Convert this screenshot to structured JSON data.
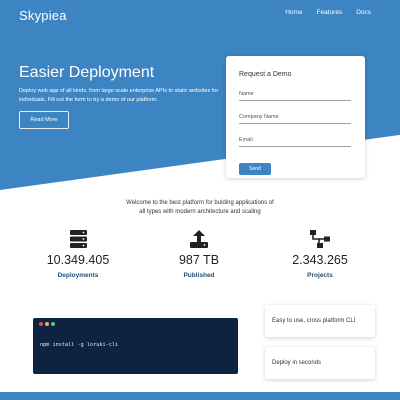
{
  "brand": "Skypiea",
  "nav": {
    "items": [
      "Home",
      "Features",
      "Docs"
    ]
  },
  "hero": {
    "title": "Easier Deployment",
    "text": "Deploy web app of all kinds, from large scale enterprise APIs to static websites for individuals. Fill out the form to try a demo of our platform.",
    "read_more": "Read More"
  },
  "demo_form": {
    "title": "Request a Demo",
    "name_placeholder": "Name",
    "company_placeholder": "Company Name",
    "email_placeholder": "Email",
    "send_label": "Send"
  },
  "welcome": {
    "line1": "Welcome to the best platform for bulding applications of",
    "line2": "all types with modern architecture and scaling"
  },
  "stats": [
    {
      "value": "10.349.405",
      "label": "Deployments",
      "icon": "server-icon"
    },
    {
      "value": "987 TB",
      "label": "Published",
      "icon": "upload-icon"
    },
    {
      "value": "2.343.265",
      "label": "Projects",
      "icon": "sitemap-icon"
    }
  ],
  "terminal": {
    "command": "npm install -g loruki-cli",
    "dot_colors": [
      "#e94b4b",
      "#e9b44b",
      "#4bd06b"
    ]
  },
  "features": [
    "Easy to use, cross platform CLI",
    "Deploy in seconds"
  ],
  "colors": {
    "primary": "#3d84c2",
    "terminal": "#0d2341",
    "stat_label": "#1f4e79"
  }
}
